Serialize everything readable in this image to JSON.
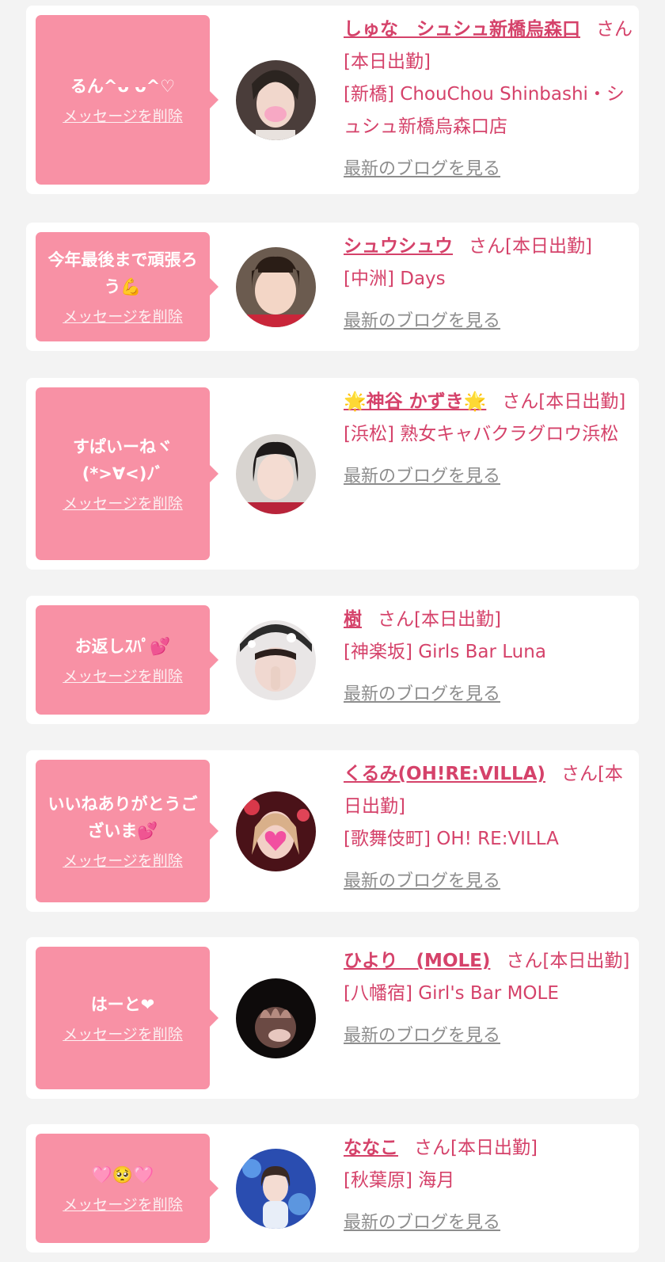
{
  "delete_label": "メッセージを削除",
  "blog_label": "最新のブログを見る",
  "entries": [
    {
      "message": "るん^ᴗ ᴗ^♡",
      "name": "しゅな　シュシュ新橋烏森口",
      "suffix": "さん[本日出勤]",
      "shop": "[新橋] ChouChou Shinbashi・シュシュ新橋烏森口店"
    },
    {
      "message": "今年最後まで頑張ろう💪",
      "name": "シュウシュウ",
      "suffix": "さん[本日出勤]",
      "shop": "[中洲] Days"
    },
    {
      "message": "すぱいーねヾ(*>∀<)ﾉﾞ",
      "name": "🌟神谷 かずき🌟",
      "suffix": "さん[本日出勤]",
      "shop": "[浜松] 熟女キャバクラグロウ浜松"
    },
    {
      "message": "お返しｽﾊﾟ💕",
      "name": "樹",
      "suffix": "さん[本日出勤]",
      "shop": "[神楽坂] Girls Bar Luna"
    },
    {
      "message": "いいねありがとうございま💕",
      "name": "くるみ(OH!RE:VILLA)",
      "suffix": "さん[本日出勤]",
      "shop": "[歌舞伎町] OH! RE:VILLA"
    },
    {
      "message": "はーと❤",
      "name": "ひより　(MOLE)",
      "suffix": "さん[本日出勤]",
      "shop": "[八幡宿] Girl's Bar MOLE"
    },
    {
      "message": "🩷🥺🩷",
      "name": "ななこ",
      "suffix": "さん[本日出勤]",
      "shop": "[秋葉原] 海月"
    }
  ],
  "colors": {
    "accent": "#d5426a",
    "bubble": "#f891a5",
    "muted": "#8d8d8d",
    "background": "#f3f3f3"
  }
}
